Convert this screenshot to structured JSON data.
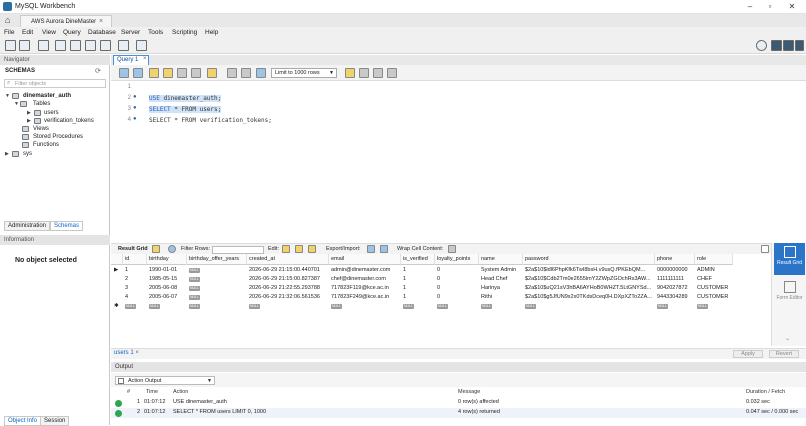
{
  "window": {
    "title": "MySQL Workbench"
  },
  "connection_tab": {
    "label": "AWS Aurora DineMaster"
  },
  "menu": [
    "File",
    "Edit",
    "View",
    "Query",
    "Database",
    "Server",
    "Tools",
    "Scripting",
    "Help"
  ],
  "navigator": {
    "header": "Navigator",
    "schemas_label": "SCHEMAS",
    "filter_placeholder": "Filter objects",
    "tree": {
      "schema": "dinemaster_auth",
      "tables": "Tables",
      "table_1": "users",
      "table_2": "verification_tokens",
      "views": "Views",
      "procedures": "Stored Procedures",
      "functions": "Functions",
      "other_schema": "sys"
    },
    "tabs": {
      "administration": "Administration",
      "schemas": "Schemas"
    },
    "info_header": "Information",
    "info_text": "No object selected",
    "bottom_tabs": {
      "object_info": "Object Info",
      "session": "Session"
    }
  },
  "query_tab": {
    "label": "Query 1"
  },
  "editor_toolbar": {
    "limit": "Limit to 1000 rows"
  },
  "editor": {
    "lines": [
      {
        "n": "1",
        "text": ""
      },
      {
        "n": "2",
        "kw": "USE",
        "text": " dinemaster_auth;"
      },
      {
        "n": "3",
        "kw": "SELECT",
        "text": " * FROM users;"
      },
      {
        "n": "4",
        "kw": "SELECT",
        "text": " * FROM verification_tokens;"
      }
    ]
  },
  "result_toolbar": {
    "result_grid": "Result Grid",
    "filter_rows": "Filter Rows:",
    "edit": "Edit:",
    "export_import": "Export/Import:",
    "wrap": "Wrap Cell Content:"
  },
  "result_grid": {
    "columns": [
      "id",
      "birthday",
      "birthday_offer_years",
      "created_at",
      "email",
      "is_verified",
      "loyalty_points",
      "name",
      "password",
      "phone",
      "role"
    ],
    "rows": [
      [
        "1",
        "1990-01-01",
        "NULL",
        "2026-06-29 21:15:00.440701",
        "admin@dinemaster.com",
        "1",
        "0",
        "System Admin",
        "$2a$10$ldl6PhpKfk6TwI8bsH.v9usQ.fPKEbQM...",
        "0000000000",
        "ADMIN"
      ],
      [
        "2",
        "1985-05-15",
        "NULL",
        "2026-06-29 21:15:00.827387",
        "chef@dinemaster.com",
        "1",
        "0",
        "Head Chef",
        "$2a$10$Cdb2Tm0e2655lmY2ZWpZGOchRs3AW...",
        "1111111111",
        "CHEF"
      ],
      [
        "3",
        "2005-06-08",
        "NULL",
        "2026-06-29 21:22:55.293788",
        "717823F119@kce.ac.in",
        "1",
        "0",
        "Harinya",
        "$2a$10$uQ21sV3hBA6AYHoB0WHZT.5LtGNYSd...",
        "9042027872",
        "CUSTOMER"
      ],
      [
        "4",
        "2005-06-07",
        "NULL",
        "2026-06-29 21:32:06.561536",
        "717823F249@kce.ac.in",
        "1",
        "0",
        "Rithi",
        "$2a$10$g5JfUN9x2x0TKdsDceq0H.DXpXZTo2ZA...",
        "9443304289",
        "CUSTOMER"
      ]
    ],
    "new_row": [
      "NULL",
      "NULL",
      "NULL",
      "NULL",
      "NULL",
      "NULL",
      "NULL",
      "NULL",
      "NULL",
      "NULL",
      "NULL"
    ]
  },
  "right_panel": {
    "result_grid": "Result Grid",
    "form_editor": "Form Editor"
  },
  "result_tab": {
    "label": "users 1",
    "apply": "Apply",
    "revert": "Revert"
  },
  "output": {
    "header": "Output",
    "mode": "Action Output",
    "columns": {
      "num": "#",
      "time": "Time",
      "action": "Action",
      "message": "Message",
      "duration": "Duration / Fetch"
    },
    "rows": [
      {
        "num": "1",
        "time": "01:07:12",
        "action": "USE dinemaster_auth",
        "message": "0 row(s) affected",
        "duration": "0.032 sec"
      },
      {
        "num": "2",
        "time": "01:07:12",
        "action": "SELECT * FROM users LIMIT 0, 1000",
        "message": "4 row(s) returned",
        "duration": "0.047 sec / 0.000 sec"
      }
    ]
  }
}
